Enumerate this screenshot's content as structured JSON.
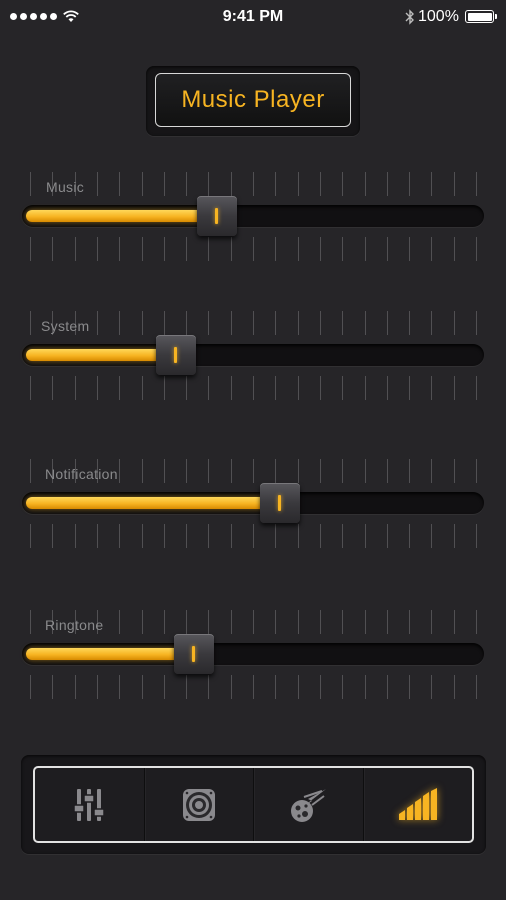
{
  "status_bar": {
    "time": "9:41 PM",
    "battery": "100%"
  },
  "title": "Music Player",
  "sliders": [
    {
      "label": "Music",
      "value_percent": 42
    },
    {
      "label": "System",
      "value_percent": 33
    },
    {
      "label": "Notification",
      "value_percent": 56
    },
    {
      "label": "Ringtone",
      "value_percent": 37
    }
  ],
  "tabs": [
    {
      "icon": "equalizer-icon",
      "active": false
    },
    {
      "icon": "speaker-icon",
      "active": false
    },
    {
      "icon": "meteor-icon",
      "active": false
    },
    {
      "icon": "volume-level-icon",
      "active": true
    }
  ],
  "colors": {
    "accent": "#f7b422",
    "background": "#262528",
    "inactive_icon": "#8a898d"
  }
}
